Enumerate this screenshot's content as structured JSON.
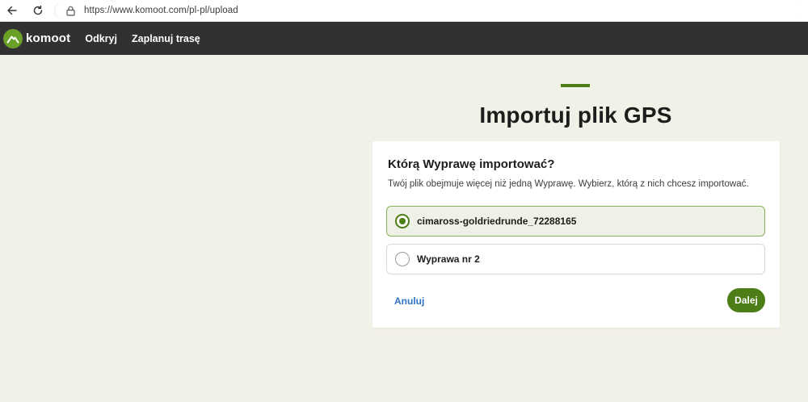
{
  "browser": {
    "url": "https://www.komoot.com/pl-pl/upload",
    "icons": {
      "back": "arrow-left-icon",
      "reload": "reload-icon",
      "lock": "lock-icon"
    }
  },
  "header": {
    "logo_text": "komoot",
    "nav": [
      {
        "label": "Odkryj"
      },
      {
        "label": "Zaplanuj trasę"
      }
    ]
  },
  "main": {
    "title": "Importuj plik GPS",
    "card": {
      "heading": "Którą Wyprawę importować?",
      "description": "Twój plik obejmuje więcej niż jedną Wyprawę. Wybierz, którą z nich chcesz importować.",
      "options": [
        {
          "label": "cimaross-goldriedrunde_72288165",
          "selected": true
        },
        {
          "label": "Wyprawa nr 2",
          "selected": false
        }
      ],
      "cancel_label": "Anuluj",
      "next_label": "Dalej"
    }
  },
  "colors": {
    "accent": "#4c7d16",
    "logo_green": "#6aa127",
    "header_bg": "#313131",
    "page_bg": "#f2f1e8",
    "link": "#2d74c4"
  }
}
